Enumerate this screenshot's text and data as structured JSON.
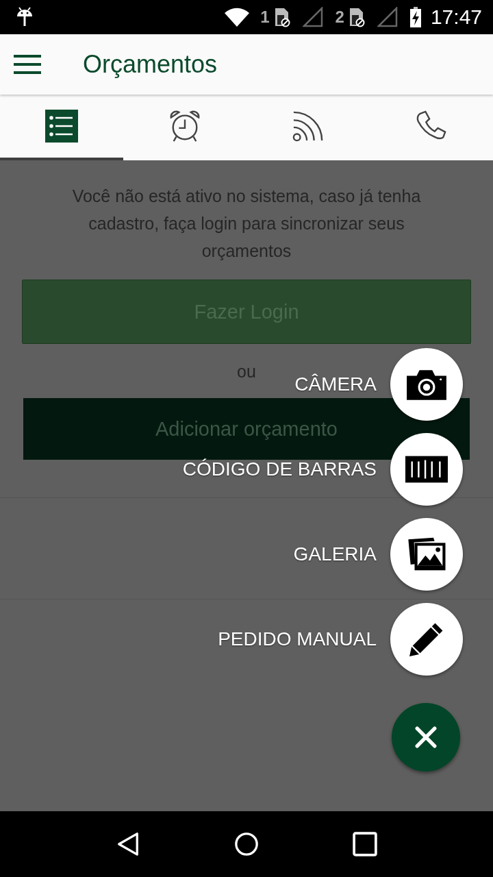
{
  "status_bar": {
    "sims": [
      "1",
      "2"
    ],
    "time": "17:47"
  },
  "app_bar": {
    "title": "Orçamentos"
  },
  "tabs": [
    {
      "kind": "list",
      "selected": true
    },
    {
      "kind": "alarm",
      "selected": false
    },
    {
      "kind": "feed",
      "selected": false
    },
    {
      "kind": "phone",
      "selected": false
    }
  ],
  "content": {
    "message": "Você não está ativo no sistema, caso já tenha cadastro, faça login para sincronizar seus orçamentos",
    "login_button": "Fazer Login",
    "separator": "ou",
    "add_button": "Adicionar orçamento"
  },
  "fab_menu": {
    "actions": [
      {
        "kind": "camera",
        "label": "CÂMERA"
      },
      {
        "kind": "barcode",
        "label": "CÓDIGO DE BARRAS"
      },
      {
        "kind": "gallery",
        "label": "GALERIA"
      },
      {
        "kind": "pencil",
        "label": "PEDIDO MANUAL"
      }
    ]
  }
}
